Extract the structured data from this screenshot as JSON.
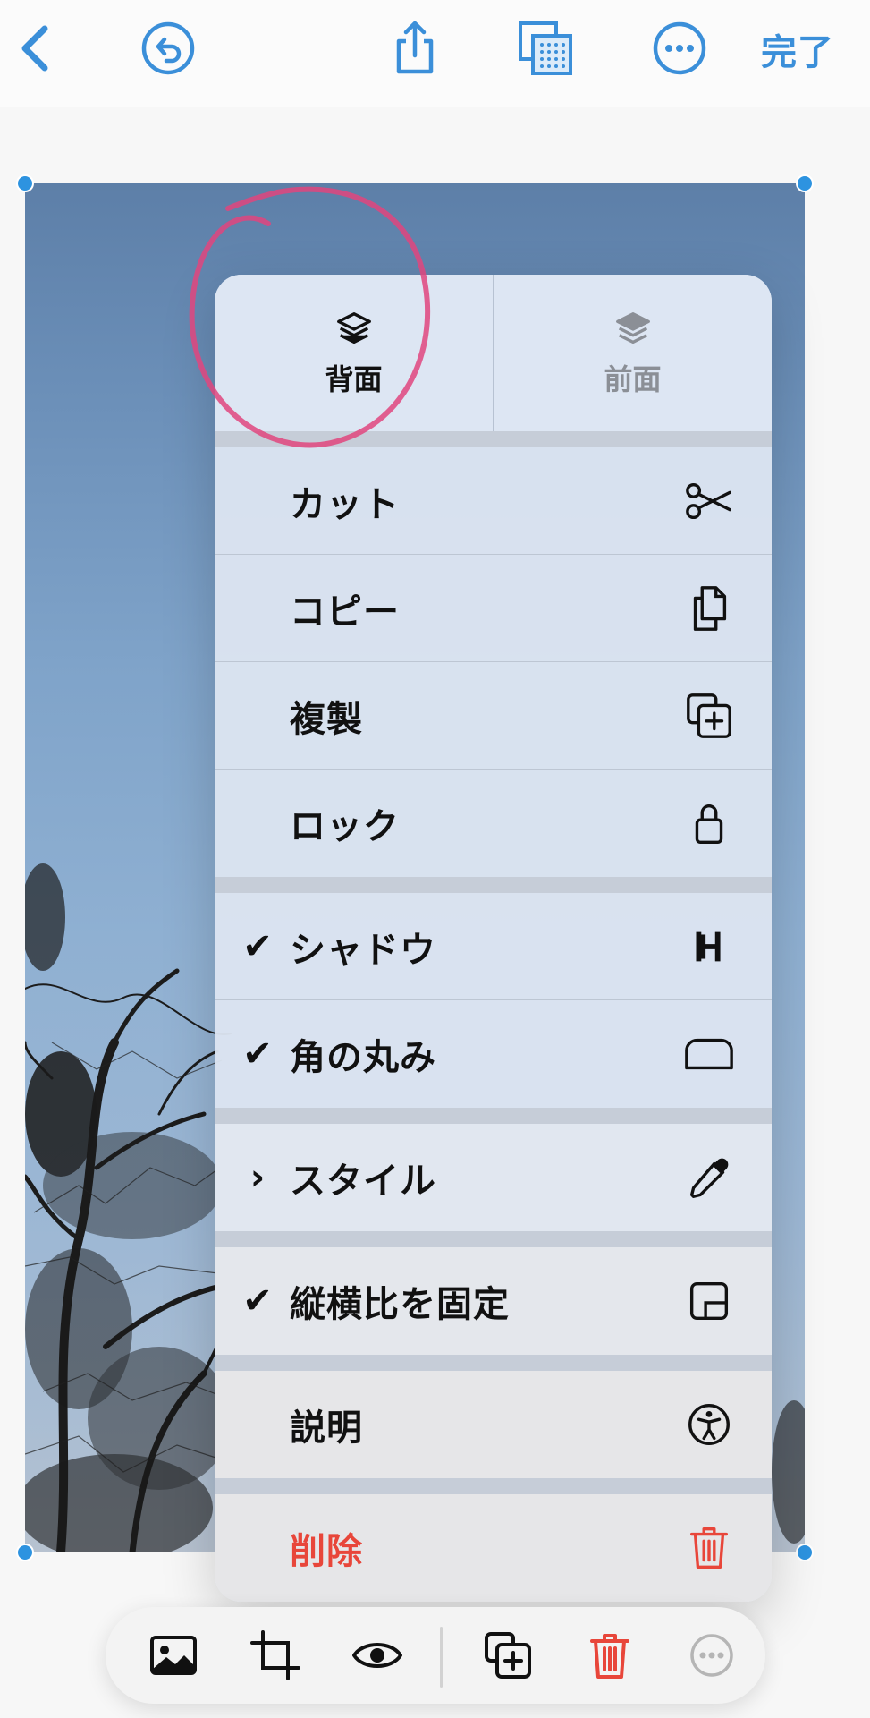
{
  "toolbar": {
    "back": "back-icon",
    "undo": "undo-icon",
    "share": "share-icon",
    "arrange": "arrange-icon",
    "more": "more-icon",
    "done_label": "完了",
    "accent_color": "#3b8fd9"
  },
  "menu": {
    "arrange": {
      "back_label": "背面",
      "front_label": "前面"
    },
    "items": [
      {
        "label": "カット",
        "icon": "scissors-icon",
        "checked": false
      },
      {
        "label": "コピー",
        "icon": "copy-icon",
        "checked": false
      },
      {
        "label": "複製",
        "icon": "duplicate-icon",
        "checked": false
      },
      {
        "label": "ロック",
        "icon": "lock-icon",
        "checked": false
      },
      {
        "label": "シャドウ",
        "icon": "shadow-icon",
        "checked": true
      },
      {
        "label": "角の丸み",
        "icon": "rounded-rect-icon",
        "checked": true
      },
      {
        "label": "スタイル",
        "icon": "eyedropper-icon",
        "submenu": true
      },
      {
        "label": "縦横比を固定",
        "icon": "aspect-lock-icon",
        "checked": true
      },
      {
        "label": "説明",
        "icon": "accessibility-icon",
        "checked": false
      },
      {
        "label": "削除",
        "icon": "trash-icon",
        "destructive": true
      }
    ],
    "check_mark": "✔",
    "submenu_mark": "›",
    "destructive_color": "#e8463a"
  },
  "bottom_bar": {
    "items": [
      "photo-icon",
      "crop-icon",
      "eye-icon",
      "duplicate-icon",
      "trash-icon",
      "more-icon"
    ],
    "trash_color": "#e8463a"
  }
}
